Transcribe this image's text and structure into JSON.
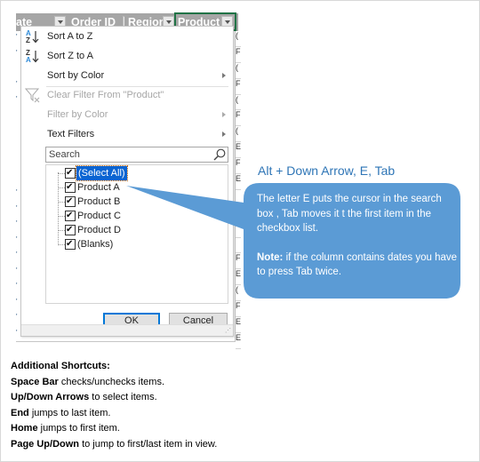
{
  "spreadsheet": {
    "headers": [
      {
        "label": "ate"
      },
      {
        "label": "Order ID"
      },
      {
        "label": "Region"
      },
      {
        "label": "Product"
      }
    ],
    "active_column": "Product"
  },
  "filter_menu": {
    "sort_az": "Sort A to Z",
    "sort_za": "Sort Z to A",
    "sort_by_color": "Sort by Color",
    "clear_filter": "Clear Filter From \"Product\"",
    "filter_by_color": "Filter by Color",
    "text_filters": "Text Filters",
    "search_placeholder": "Search",
    "items": [
      {
        "label": "(Select All)",
        "checked": true,
        "selected": true
      },
      {
        "label": "Product A",
        "checked": true
      },
      {
        "label": "Product B",
        "checked": true
      },
      {
        "label": "Product C",
        "checked": true
      },
      {
        "label": "Product D",
        "checked": true
      },
      {
        "label": "(Blanks)",
        "checked": true
      }
    ],
    "ok_label": "OK",
    "cancel_label": "Cancel"
  },
  "callout": {
    "title": "Alt + Down Arrow, E, Tab",
    "body": "The letter E puts the cursor in the search box , Tab moves it t the first item in the checkbox list.",
    "note_label": "Note:",
    "note_text": " if the column contains dates you have to press Tab twice.",
    "color": "#5b9bd5",
    "title_color": "#2e75b6"
  },
  "notes": {
    "heading": "Additional Shortcuts:",
    "lines": [
      {
        "key": "Space Bar",
        "text": " checks/unchecks items."
      },
      {
        "key": "Up/Down Arrows",
        "text": " to select items."
      },
      {
        "key": "End",
        "text": " jumps to last item."
      },
      {
        "key": "Home",
        "text": " jumps to first item."
      },
      {
        "key": "Page Up/Down",
        "text": " to jump to first/last item in view."
      }
    ]
  }
}
